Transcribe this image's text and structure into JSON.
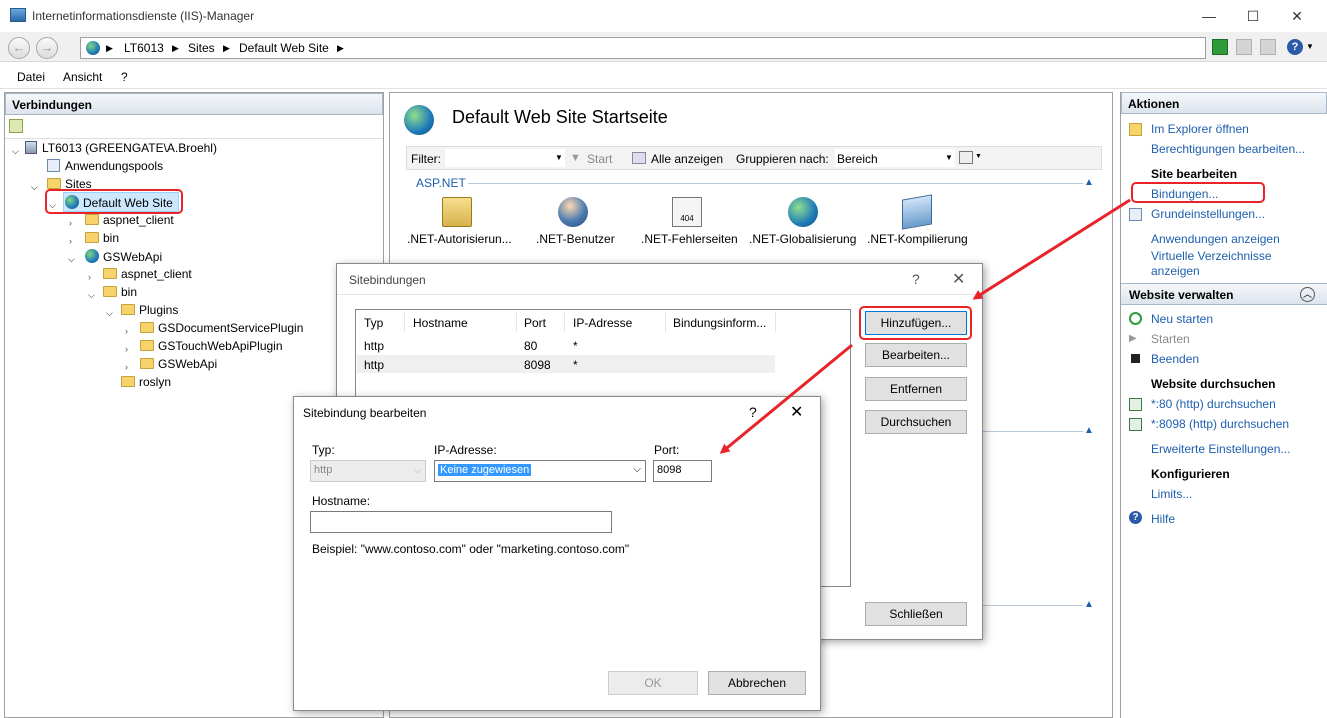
{
  "window": {
    "title": "Internetinformationsdienste (IIS)-Manager"
  },
  "address": {
    "items": [
      "LT6013",
      "Sites",
      "Default Web Site"
    ]
  },
  "menu": {
    "items": [
      "Datei",
      "Ansicht",
      "?"
    ]
  },
  "connections": {
    "title": "Verbindungen",
    "tree": [
      {
        "label": "LT6013 (GREENGATE\\A.Broehl)"
      },
      {
        "label": "Anwendungspools"
      },
      {
        "label": "Sites"
      },
      {
        "label": "Default Web Site"
      },
      {
        "label": "aspnet_client"
      },
      {
        "label": "bin"
      },
      {
        "label": "GSWebApi"
      },
      {
        "label": "aspnet_client"
      },
      {
        "label": "bin"
      },
      {
        "label": "Plugins"
      },
      {
        "label": "GSDocumentServicePlugin"
      },
      {
        "label": "GSTouchWebApiPlugin"
      },
      {
        "label": "GSWebApi"
      },
      {
        "label": "roslyn"
      }
    ]
  },
  "center": {
    "title": "Default Web Site Startseite",
    "filter_label": "Filter:",
    "start_label": "Start",
    "show_all_label": "Alle anzeigen",
    "group_label": "Gruppieren nach:",
    "group_value": "Bereich",
    "section": "ASP.NET",
    "features": [
      ".NET-Autorisierun...",
      ".NET-Benutzer",
      ".NET-Fehlerseiten",
      ".NET-Globalisierung",
      ".NET-Kompilierung"
    ],
    "error_icon_text": "404"
  },
  "actions": {
    "title": "Aktionen",
    "explorer": "Im Explorer öffnen",
    "permissions": "Berechtigungen bearbeiten...",
    "site_edit_head": "Site bearbeiten",
    "bindings": "Bindungen...",
    "basic_settings": "Grundeinstellungen...",
    "show_apps": "Anwendungen anzeigen",
    "virtual_dirs": "Virtuelle Verzeichnisse anzeigen",
    "manage_head": "Website verwalten",
    "restart": "Neu starten",
    "start": "Starten",
    "stop": "Beenden",
    "browse_head": "Website durchsuchen",
    "browse80": "*:80 (http) durchsuchen",
    "browse8098": "*:8098 (http) durchsuchen",
    "advanced": "Erweiterte Einstellungen...",
    "configure_head": "Konfigurieren",
    "limits": "Limits...",
    "help": "Hilfe"
  },
  "bindings_dialog": {
    "title": "Sitebindungen",
    "help": "?",
    "columns": [
      "Typ",
      "Hostname",
      "Port",
      "IP-Adresse",
      "Bindungsinform..."
    ],
    "rows": [
      {
        "type": "http",
        "host": "",
        "port": "80",
        "ip": "*"
      },
      {
        "type": "http",
        "host": "",
        "port": "8098",
        "ip": "*"
      }
    ],
    "add": "Hinzufügen...",
    "edit": "Bearbeiten...",
    "remove": "Entfernen",
    "browse": "Durchsuchen",
    "close": "Schließen"
  },
  "edit_dialog": {
    "title": "Sitebindung bearbeiten",
    "help": "?",
    "type_label": "Typ:",
    "type_value": "http",
    "ip_label": "IP-Adresse:",
    "ip_value": "Keine zugewiesen",
    "port_label": "Port:",
    "port_value": "8098",
    "hostname_label": "Hostname:",
    "hostname_value": "",
    "example": "Beispiel: \"www.contoso.com\" oder \"marketing.contoso.com\"",
    "ok": "OK",
    "cancel": "Abbrechen"
  },
  "colors": {
    "link": "#1e5fae",
    "highlight": "#cce8ff",
    "annotation": "#e8242a",
    "select": "#3399ff"
  }
}
